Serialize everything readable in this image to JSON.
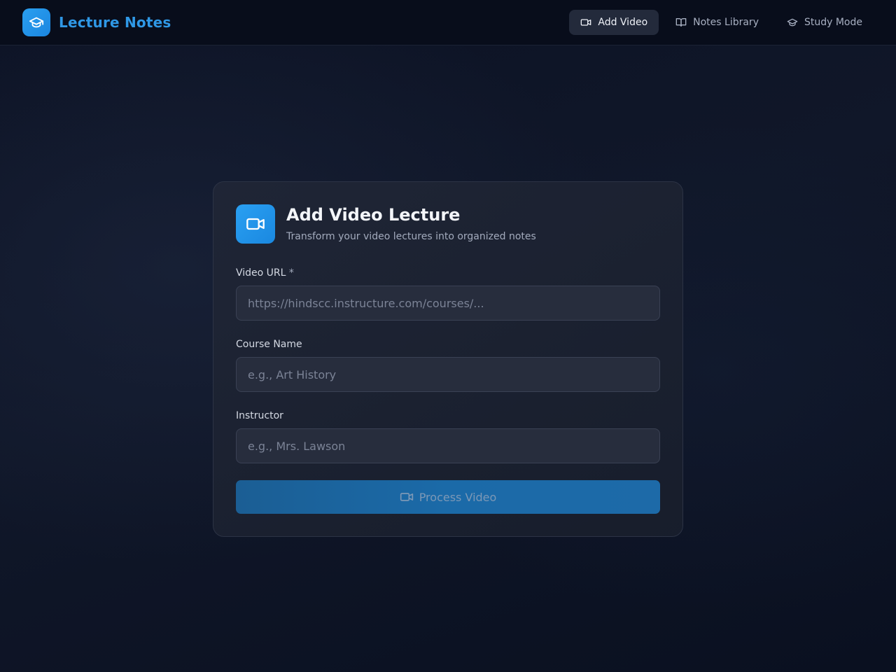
{
  "app": {
    "title": "Lecture Notes",
    "logo_icon": "graduation-cap-icon"
  },
  "nav": {
    "items": [
      {
        "label": "Add Video",
        "icon": "video-camera-icon",
        "active": true
      },
      {
        "label": "Notes Library",
        "icon": "open-book-icon",
        "active": false
      },
      {
        "label": "Study Mode",
        "icon": "graduation-cap-icon",
        "active": false
      }
    ]
  },
  "form": {
    "title": "Add Video Lecture",
    "subtitle": "Transform your video lectures into organized notes",
    "header_icon": "video-camera-icon",
    "fields": [
      {
        "label": "Video URL",
        "required_mark": "*",
        "placeholder": "https://hindscc.instructure.com/courses/...",
        "value": ""
      },
      {
        "label": "Course Name",
        "required_mark": "",
        "placeholder": "e.g., Art History",
        "value": ""
      },
      {
        "label": "Instructor",
        "required_mark": "",
        "placeholder": "e.g., Mrs. Lawson",
        "value": ""
      }
    ],
    "submit_label": "Process Video",
    "submit_icon": "video-camera-icon"
  },
  "colors": {
    "accent": "#2f98e6",
    "background": "#0c1224",
    "card": "#1e2434",
    "button": "#1b6aa8"
  }
}
